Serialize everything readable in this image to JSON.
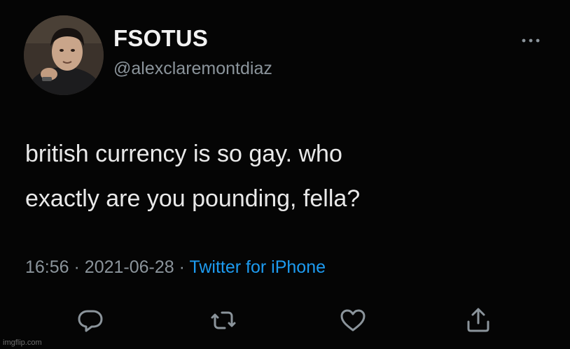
{
  "user": {
    "display_name": "FSOTUS",
    "handle": "@alexclaremontdiaz"
  },
  "tweet": {
    "lines": [
      "british currency is so gay. who",
      "exactly are you pounding, fella?"
    ],
    "time": "16:56",
    "date": "2021-06-28",
    "separator": "·",
    "source": "Twitter for iPhone"
  },
  "icons": {
    "more": "more-dots-icon",
    "reply": "reply-icon",
    "retweet": "retweet-icon",
    "like": "heart-icon",
    "share": "share-icon"
  },
  "colors": {
    "background": "#050505",
    "text": "#e9e9e9",
    "muted": "#8b949b",
    "link": "#1d9bf0"
  },
  "watermark": "imgflip.com"
}
